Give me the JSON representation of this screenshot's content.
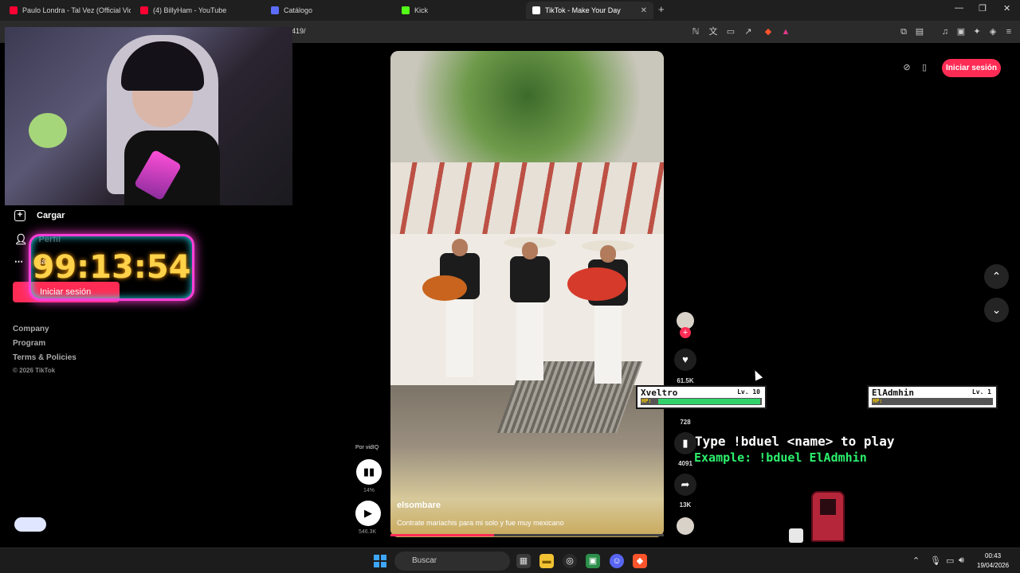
{
  "browser": {
    "tabs": [
      {
        "title": "Paulo Londra - Tal Vez (Official Video)",
        "favicon": "youtube-icon",
        "color": "#ff0033"
      },
      {
        "title": "(4) BillyHam - YouTube",
        "favicon": "youtube-icon",
        "color": "#ff0033"
      },
      {
        "title": "Catálogo",
        "favicon": "roblox-icon",
        "color": "#5b6cff"
      },
      {
        "title": "Kick",
        "favicon": "kick-icon",
        "color": "#53fc18"
      },
      {
        "title": "TikTok - Make Your Day",
        "favicon": "tiktok-icon",
        "color": "#ffffff"
      }
    ],
    "new_tab": "+",
    "url_fragment": "419/"
  },
  "sidebar": {
    "upload_label": "Cargar",
    "profile_label": "Perfil",
    "more_label": "Más",
    "login_label": "Iniciar sesión",
    "links": [
      "Company",
      "Program",
      "Terms & Policies"
    ],
    "copyright": "© 2026 TikTok"
  },
  "stream_overlay": {
    "timer": "99:13:54"
  },
  "header": {
    "login_label": "Iniciar sesión"
  },
  "video": {
    "username": "elsombare",
    "caption": "Contrate mariachis para mi solo y fue muy mexicano",
    "progress": 0.38
  },
  "actions": {
    "likes": "61.5K",
    "comments": "728",
    "saves": "4091",
    "shares": "13K"
  },
  "vidiq": {
    "label": "Por vidIQ",
    "percent": "14%",
    "views": "546.3K"
  },
  "game": {
    "player1": {
      "name": "Xveltro",
      "level": "Lv. 10",
      "hp_label": "HP:",
      "hp": 1.0
    },
    "player2": {
      "name": "ElAdmhin",
      "level": "Lv. 1",
      "hp_label": "HP:",
      "hp": 0.0
    },
    "instruction": "Type !bduel <name> to play",
    "example": "Example: !bduel ElAdmhin"
  },
  "taskbar": {
    "search_placeholder": "Buscar",
    "time": "00:43",
    "date": "19/04/2026"
  }
}
